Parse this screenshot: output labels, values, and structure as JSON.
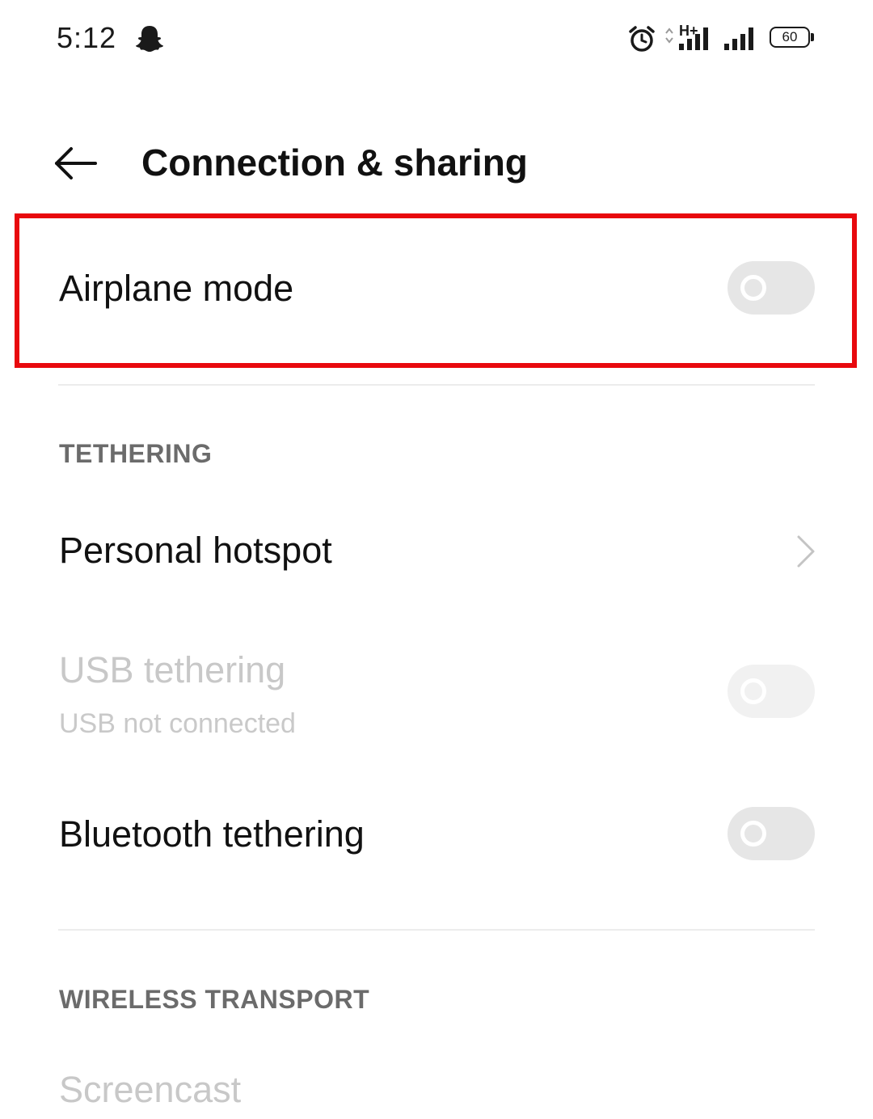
{
  "status_bar": {
    "time": "5:12",
    "network_type": "H+",
    "battery_level": "60",
    "icons": [
      "snapchat-icon",
      "alarm-icon",
      "data-arrows-icon",
      "signal-icon",
      "signal-icon",
      "battery-icon"
    ]
  },
  "header": {
    "title": "Connection & sharing",
    "back_icon": "arrow-left-icon"
  },
  "colors": {
    "highlight": "#e8090e",
    "toggle_off": "#e6e6e6",
    "section_header": "#6b6b6b",
    "disabled_text": "#c8c8c8"
  },
  "settings": {
    "airplane_mode": {
      "label": "Airplane mode",
      "enabled": false
    },
    "tethering": {
      "header": "TETHERING",
      "personal_hotspot": {
        "label": "Personal hotspot"
      },
      "usb_tethering": {
        "label": "USB tethering",
        "subtitle": "USB not connected",
        "enabled": false
      },
      "bluetooth_tethering": {
        "label": "Bluetooth tethering",
        "enabled": false
      }
    },
    "wireless_transport": {
      "header": "WIRELESS TRANSPORT",
      "screencast": {
        "label": "Screencast"
      }
    }
  }
}
